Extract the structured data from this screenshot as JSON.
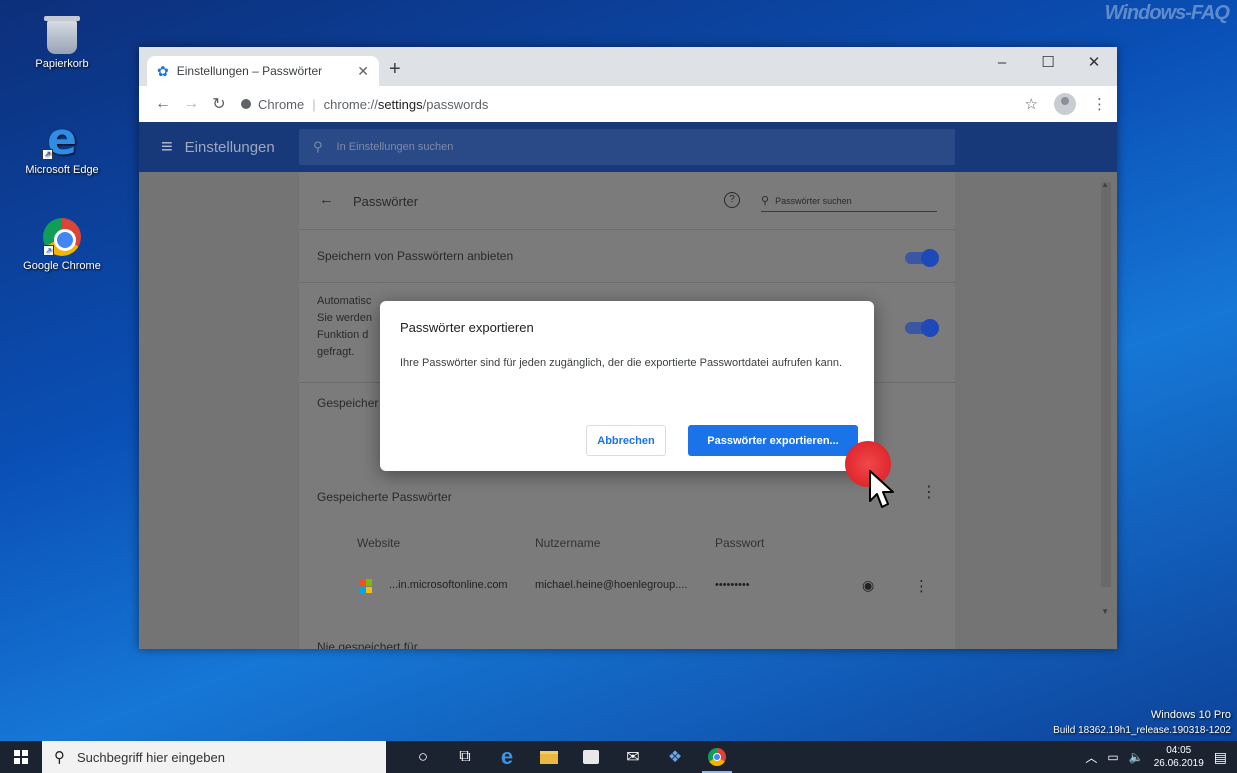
{
  "desktop": {
    "watermark": "Windows-FAQ",
    "icons": [
      {
        "label": "Papierkorb"
      },
      {
        "label": "Microsoft Edge"
      },
      {
        "label": "Google Chrome"
      }
    ],
    "build_line1": "Windows 10 Pro",
    "build_line2": "Build 18362.19h1_release.190318-1202"
  },
  "browser": {
    "tab_title": "Einstellungen – Passwörter",
    "omnibox_scheme_label": "Chrome",
    "omnibox_url_prefix": "chrome://",
    "omnibox_url_bold": "settings",
    "omnibox_url_suffix": "/passwords",
    "window_controls": {
      "minimize": "–",
      "maximize": "☐",
      "close": "✕"
    }
  },
  "settings": {
    "app_title": "Einstellungen",
    "search_placeholder": "In Einstellungen suchen",
    "page_title": "Passwörter",
    "password_search_placeholder": "Passwörter suchen",
    "offer_to_save": "Speichern von Passwörtern anbieten",
    "offer_to_save_enabled": true,
    "auto_signin_lines": [
      "Automatisc",
      "Sie werden",
      "Funktion d",
      "gefragt."
    ],
    "auto_signin_enabled": true,
    "saved_partial": "Gespeicher",
    "saved_passwords_heading": "Gespeicherte Passwörter",
    "columns": [
      "Website",
      "Nutzername",
      "Passwort"
    ],
    "entries": [
      {
        "website": "...in.microsoftonline.com",
        "username": "michael.heine@hoenlegroup....",
        "password": "•••••••••"
      }
    ],
    "never_saved_partial": "Nie gespeichert für"
  },
  "dialog": {
    "title": "Passwörter exportieren",
    "body": "Ihre Passwörter sind für jeden zugänglich, der die exportierte Passwortdatei aufrufen kann.",
    "cancel_label": "Abbrechen",
    "confirm_label": "Passwörter exportieren..."
  },
  "taskbar": {
    "search_placeholder": "Suchbegriff hier eingeben",
    "time": "04:05",
    "date": "26.06.2019"
  },
  "colors": {
    "chrome_blue": "#1a73e8",
    "settings_header": "#173979",
    "click_marker": "#e0282e"
  }
}
